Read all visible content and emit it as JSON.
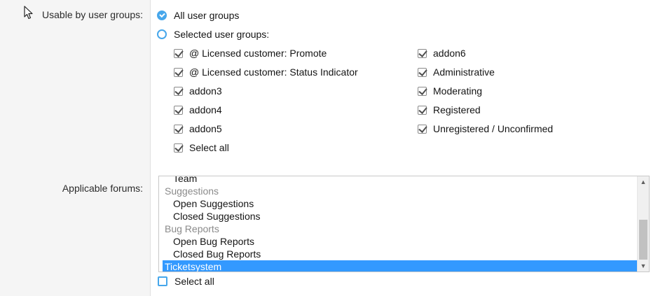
{
  "user_groups": {
    "label": "Usable by user groups:",
    "option_all": "All user groups",
    "option_selected": "Selected user groups:",
    "left_column": [
      "@ Licensed customer: Promote",
      "@ Licensed customer: Status Indicator",
      "addon3",
      "addon4",
      "addon5",
      "Select all"
    ],
    "right_column": [
      "addon6",
      "Administrative",
      "Moderating",
      "Registered",
      "Unregistered / Unconfirmed"
    ]
  },
  "forums": {
    "label": "Applicable forums:",
    "items": [
      {
        "text": "Team",
        "kind": "child"
      },
      {
        "text": "Suggestions",
        "kind": "group"
      },
      {
        "text": "Open Suggestions",
        "kind": "child"
      },
      {
        "text": "Closed Suggestions",
        "kind": "child"
      },
      {
        "text": "Bug Reports",
        "kind": "group"
      },
      {
        "text": "Open Bug Reports",
        "kind": "child"
      },
      {
        "text": "Closed Bug Reports",
        "kind": "child"
      },
      {
        "text": "Ticketsystem",
        "kind": "selected"
      }
    ],
    "select_all": "Select all",
    "scroll_up_icon": "▲",
    "scroll_down_icon": "▼"
  },
  "colors": {
    "accent": "#47a7eb",
    "selection": "#3399ff",
    "label_column_bg": "#f5f5f5"
  }
}
